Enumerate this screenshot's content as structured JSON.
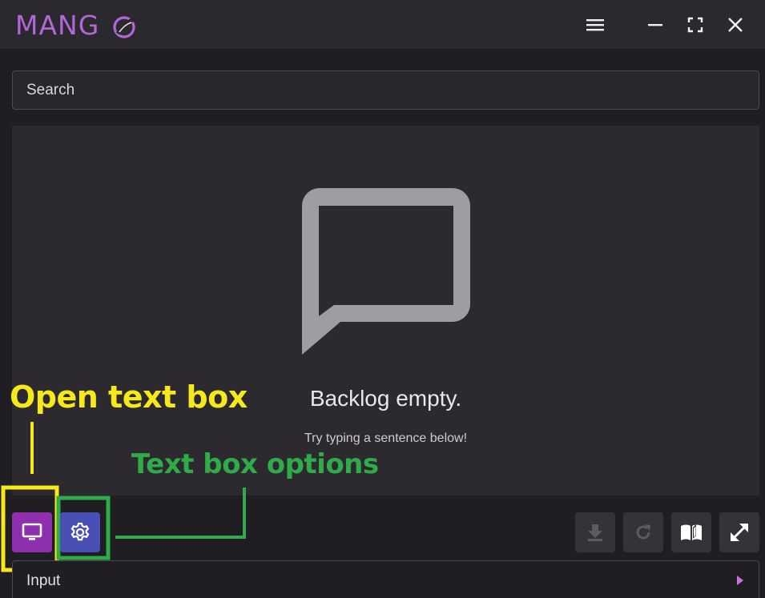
{
  "app": {
    "logo_text": "MANG",
    "logo_color": "#b267d8"
  },
  "titlebar": {
    "menu_icon": "hamburger-icon",
    "minimize_icon": "minimize-icon",
    "fullscreen_icon": "fullscreen-icon",
    "close_icon": "close-icon"
  },
  "search": {
    "placeholder": "Search",
    "value": ""
  },
  "backlog": {
    "icon": "speech-bubble-icon",
    "empty_title": "Backlog empty.",
    "empty_subtitle": "Try typing a sentence below!"
  },
  "toolbar": {
    "left": [
      {
        "name": "open-text-box-button",
        "icon": "monitor-icon",
        "color": "#8e2fb0"
      },
      {
        "name": "text-box-options-button",
        "icon": "gear-icon",
        "color": "#4a4fb5"
      }
    ],
    "right": [
      {
        "name": "download-button",
        "icon": "download-icon",
        "disabled": true
      },
      {
        "name": "refresh-button",
        "icon": "refresh-icon",
        "disabled": true
      },
      {
        "name": "dictionary-button",
        "icon": "open-book-icon",
        "disabled": false
      },
      {
        "name": "expand-button",
        "icon": "expand-arrows-icon",
        "disabled": false
      }
    ]
  },
  "input": {
    "label": "Input",
    "send_icon": "caret-right-icon"
  },
  "annotations": {
    "open_text_box": "Open text box",
    "open_text_box_color": "#f6e81a",
    "text_box_options": "Text box options",
    "text_box_options_color": "#2fac49"
  }
}
